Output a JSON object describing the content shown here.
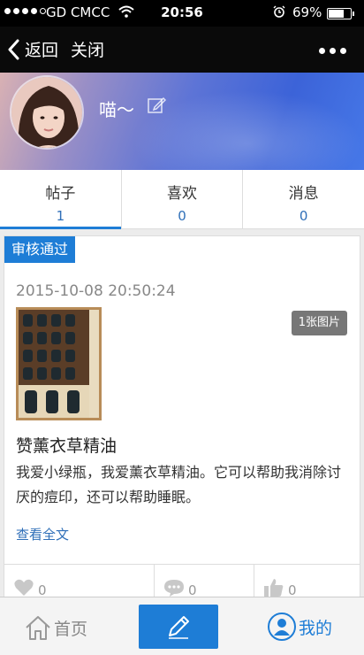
{
  "status_bar": {
    "carrier": "GD CMCC",
    "time": "20:56",
    "battery": "69%",
    "battery_level": 0.69
  },
  "nav": {
    "back_label": "返回",
    "close_label": "关闭"
  },
  "profile": {
    "username": "喵～"
  },
  "tabs": [
    {
      "label": "帖子",
      "count": "1"
    },
    {
      "label": "喜欢",
      "count": "0"
    },
    {
      "label": "消息",
      "count": "0"
    }
  ],
  "post": {
    "badge": "审核通过",
    "date": "2015-10-08 20:50:24",
    "image_count": "1张图片",
    "title": "赞薰衣草精油",
    "excerpt": "我爱小绿瓶，我爱薰衣草精油。它可以帮助我消除讨厌的痘印，还可以帮助睡眠。",
    "read_more": "查看全文",
    "likes": "0",
    "comments": "0",
    "thumbs_up": "0"
  },
  "bottom_nav": {
    "home_label": "首页",
    "mine_label": "我的"
  },
  "colors": {
    "accent": "#1e7dd6",
    "link": "#2f6fb8",
    "nav_bg": "#0a0a0a"
  },
  "icons": [
    "back-chevron-icon",
    "more-icon",
    "edit-icon",
    "heart-icon",
    "comment-icon",
    "thumbs-up-icon",
    "home-icon",
    "pencil-icon",
    "user-icon",
    "wifi-icon",
    "alarm-icon"
  ]
}
